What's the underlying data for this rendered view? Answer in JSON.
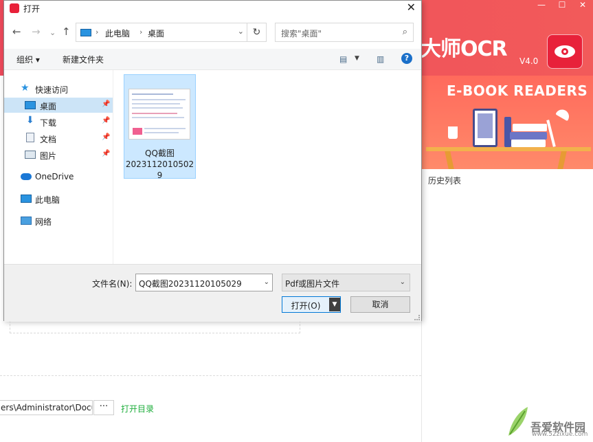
{
  "app": {
    "window_controls": [
      "—",
      "☐",
      "✕"
    ],
    "brand_title": "大师OCR",
    "brand_version": "V4.0",
    "banner_title": "E-BOOK READERS",
    "history_label": "历史列表",
    "path_value": "ers\\Administrator\\Docu",
    "more_label": "···",
    "open_dir_label": "打开目录",
    "watermark_text": "吾爱软件园",
    "watermark_url": "www.52zixue.com",
    "accent_color": "#ee4a5b"
  },
  "dialog": {
    "title": "打开",
    "close_label": "✕",
    "nav": {
      "back": "←",
      "forward": "→",
      "up": "↑",
      "refresh": "↻"
    },
    "address": {
      "root": "此电脑",
      "current": "桌面"
    },
    "search": {
      "placeholder": "搜索\"桌面\""
    },
    "toolbar": {
      "organize": "组织 ▾",
      "new_folder": "新建文件夹",
      "help": "?"
    },
    "sidebar": {
      "quick_access": "快速访问",
      "items": [
        {
          "label": "桌面",
          "selected": true
        },
        {
          "label": "下载"
        },
        {
          "label": "文档"
        },
        {
          "label": "图片"
        }
      ],
      "onedrive": "OneDrive",
      "this_pc": "此电脑",
      "network": "网络"
    },
    "files": [
      {
        "name_line1": "QQ截图",
        "name_line2": "2023112010502",
        "name_line3": "9"
      }
    ],
    "bottom": {
      "filename_label": "文件名(N):",
      "filename_value": "QQ截图20231120105029",
      "filetype_value": "Pdf或图片文件",
      "open_label": "打开(O)",
      "cancel_label": "取消"
    }
  }
}
